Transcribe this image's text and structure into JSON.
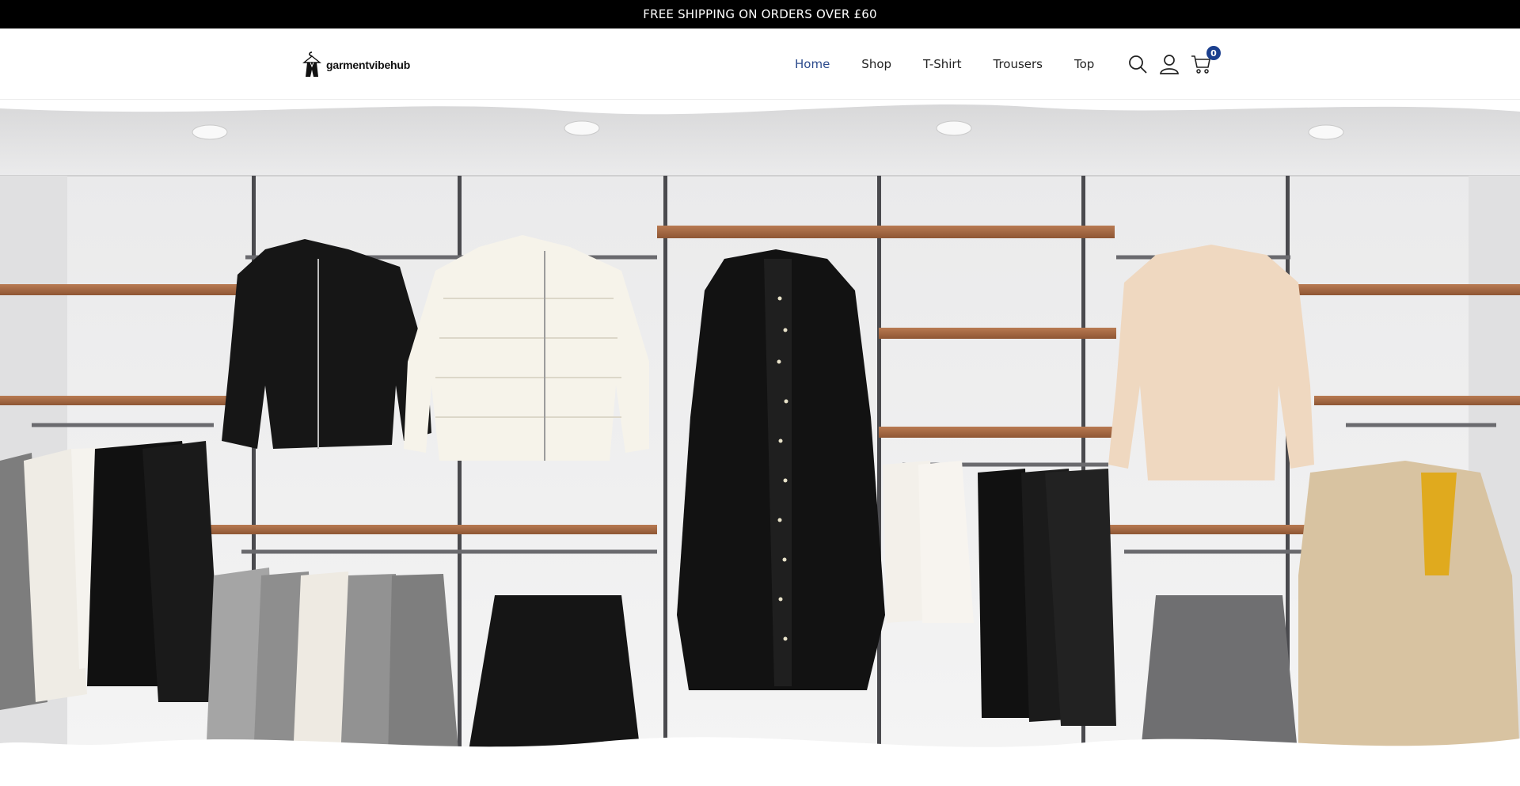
{
  "announcement": {
    "text": "FREE SHIPPING ON ORDERS OVER £60"
  },
  "brand": {
    "name": "garmentvibehub"
  },
  "nav": {
    "items": [
      {
        "label": "Home",
        "active": true
      },
      {
        "label": "Shop"
      },
      {
        "label": "T-Shirt"
      },
      {
        "label": "Trousers"
      },
      {
        "label": "Top"
      }
    ]
  },
  "header_icons": {
    "search": "search-icon",
    "account": "user-icon",
    "cart": "cart-icon",
    "cart_count": "0"
  },
  "colors": {
    "announcement_bg": "#000000",
    "nav_active": "#2b4a8c",
    "cart_badge": "#1b3f8e"
  }
}
